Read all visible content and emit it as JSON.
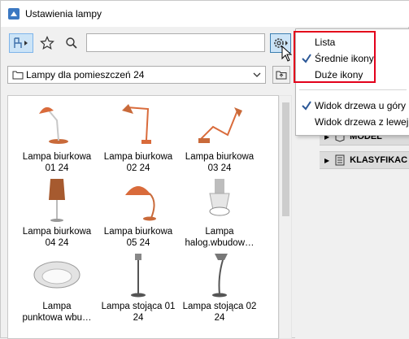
{
  "window": {
    "title": "Ustawienia lampy"
  },
  "toolbar": {
    "search_value": "",
    "folder_label": "Lampy dla pomieszczeń 24"
  },
  "menu": {
    "items": [
      {
        "label": "Lista",
        "checked": false
      },
      {
        "label": "Średnie ikony",
        "checked": true
      },
      {
        "label": "Duże ikony",
        "checked": false
      },
      {
        "label": "Widok drzewa u góry",
        "checked": true
      },
      {
        "label": "Widok drzewa z lewej",
        "checked": false
      }
    ]
  },
  "right_panel": {
    "rows": [
      {
        "label": "MODEL"
      },
      {
        "label": "KLASYFIKAC"
      }
    ]
  },
  "items": [
    {
      "line1": "Lampa biurkowa",
      "line2": "01 24"
    },
    {
      "line1": "Lampa biurkowa",
      "line2": "02 24"
    },
    {
      "line1": "Lampa biurkowa",
      "line2": "03 24"
    },
    {
      "line1": "Lampa biurkowa",
      "line2": "04 24"
    },
    {
      "line1": "Lampa biurkowa",
      "line2": "05 24"
    },
    {
      "line1": "Lampa",
      "line2": "halog.wbudow…"
    },
    {
      "line1": "Lampa",
      "line2": "punktowa wbu…"
    },
    {
      "line1": "Lampa stojąca 01",
      "line2": "24"
    },
    {
      "line1": "Lampa stojąca 02",
      "line2": "24"
    }
  ],
  "colors": {
    "accent": "#cce4f7",
    "lamp": "#d96b3b",
    "highlight": "#e3001b"
  }
}
